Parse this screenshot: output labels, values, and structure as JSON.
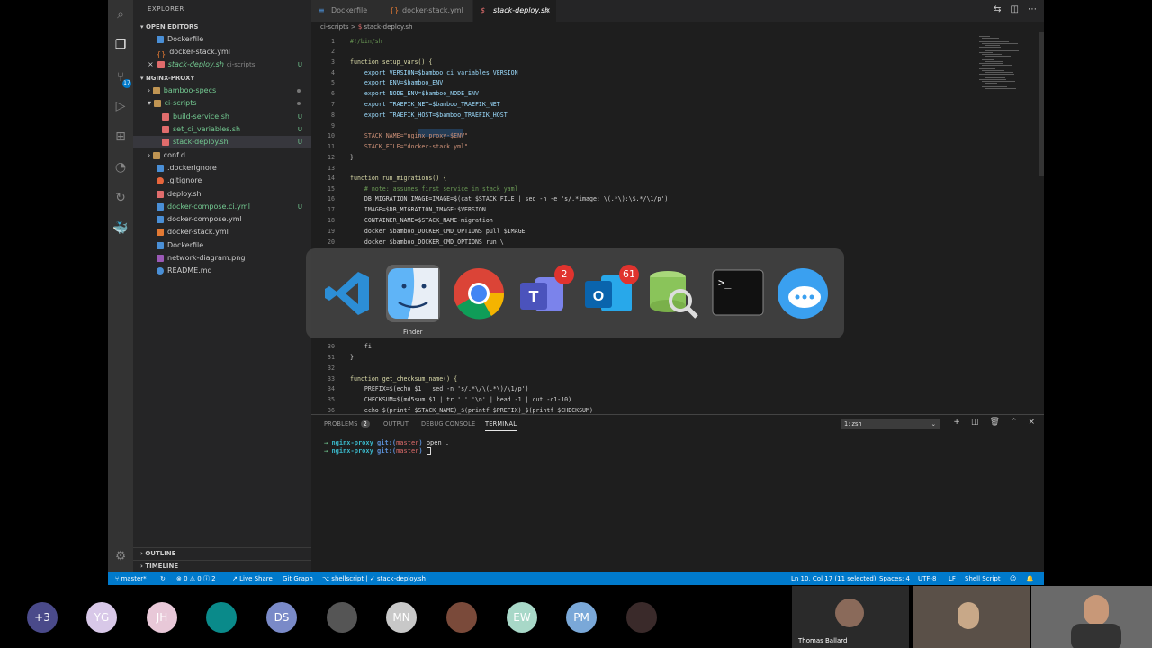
{
  "explorer": {
    "title": "EXPLORER",
    "open_editors_label": "OPEN EDITORS",
    "open_editors": [
      {
        "name": "Dockerfile"
      },
      {
        "name": "docker-stack.yml"
      },
      {
        "name": "stack-deploy.sh",
        "desc": "ci-scripts",
        "status": "U"
      }
    ],
    "project_label": "NGINX-PROXY",
    "tree": [
      {
        "name": "bamboo-specs",
        "status": ""
      },
      {
        "name": "ci-scripts",
        "status": ""
      },
      {
        "name": "build-service.sh",
        "status": "U"
      },
      {
        "name": "set_ci_variables.sh",
        "status": "U"
      },
      {
        "name": "stack-deploy.sh",
        "status": "U"
      },
      {
        "name": "conf.d",
        "status": ""
      },
      {
        "name": ".dockerignore",
        "status": ""
      },
      {
        "name": ".gitignore",
        "status": ""
      },
      {
        "name": "deploy.sh",
        "status": ""
      },
      {
        "name": "docker-compose.ci.yml",
        "status": "U"
      },
      {
        "name": "docker-compose.yml",
        "status": ""
      },
      {
        "name": "docker-stack.yml",
        "status": ""
      },
      {
        "name": "Dockerfile",
        "status": ""
      },
      {
        "name": "network-diagram.png",
        "status": ""
      },
      {
        "name": "README.md",
        "status": ""
      }
    ],
    "outline_label": "OUTLINE",
    "timeline_label": "TIMELINE"
  },
  "tabs": [
    {
      "label": "Dockerfile"
    },
    {
      "label": "docker-stack.yml"
    },
    {
      "label": "stack-deploy.sh"
    }
  ],
  "breadcrumb": {
    "folder": "ci-scripts",
    "sep": ">",
    "file": "stack-deploy.sh"
  },
  "code_lines": [
    {
      "n": "1",
      "t": "#!/bin/sh"
    },
    {
      "n": "2",
      "t": ""
    },
    {
      "n": "3",
      "t": "function setup_vars() {"
    },
    {
      "n": "4",
      "t": "    export VERSION=$bamboo_ci_variables_VERSION"
    },
    {
      "n": "5",
      "t": "    export ENV=$bamboo_ENV"
    },
    {
      "n": "6",
      "t": "    export NODE_ENV=$bamboo_NODE_ENV"
    },
    {
      "n": "7",
      "t": "    export TRAEFIK_NET=$bamboo_TRAEFIK_NET"
    },
    {
      "n": "8",
      "t": "    export TRAEFIK_HOST=$bamboo_TRAEFIK_HOST"
    },
    {
      "n": "9",
      "t": ""
    },
    {
      "n": "10",
      "t": "    STACK_NAME=\"nginx_proxy-$ENV\""
    },
    {
      "n": "11",
      "t": "    STACK_FILE=\"docker-stack.yml\""
    },
    {
      "n": "12",
      "t": "}"
    },
    {
      "n": "13",
      "t": ""
    },
    {
      "n": "14",
      "t": "function run_migrations() {"
    },
    {
      "n": "15",
      "t": "    # note: assumes first service in stack yaml"
    },
    {
      "n": "16",
      "t": "    DB_MIGRATION_IMAGE=IMAGE=$(cat $STACK_FILE | sed -n -e 's/.*image: \\(.*\\):\\$.*/\\1/p')"
    },
    {
      "n": "17",
      "t": "    IMAGE=$DB_MIGRATION_IMAGE:$VERSION"
    },
    {
      "n": "18",
      "t": "    CONTAINER_NAME=$STACK_NAME-migration"
    },
    {
      "n": "19",
      "t": "    docker $bamboo_DOCKER_CMD_OPTIONS pull $IMAGE"
    },
    {
      "n": "20",
      "t": "    docker $bamboo_DOCKER_CMD_OPTIONS run \\"
    },
    {
      "n": "30",
      "t": "    fi"
    },
    {
      "n": "31",
      "t": "}"
    },
    {
      "n": "32",
      "t": ""
    },
    {
      "n": "33",
      "t": "function get_checksum_name() {"
    },
    {
      "n": "34",
      "t": "    PREFIX=$(echo $1 | sed -n 's/.*\\/\\(.*\\)/\\1/p')"
    },
    {
      "n": "35",
      "t": "    CHECKSUM=$(md5sum $1 | tr ' ' '\\n' | head -1 | cut -c1-10)"
    },
    {
      "n": "36",
      "t": "    echo $(printf $STACK_NAME)_$(printf $PREFIX)_$(printf $CHECKSUM)"
    }
  ],
  "panel": {
    "tabs": [
      "PROBLEMS",
      "OUTPUT",
      "DEBUG CONSOLE",
      "TERMINAL"
    ],
    "problems_count": "2",
    "terminal_select": "1: zsh",
    "lines": [
      {
        "arrow": "→",
        "dir": "nginx-proxy",
        "git": "git:(",
        "branch": "master",
        "close": ")",
        "cmd": " open ."
      },
      {
        "arrow": "→",
        "dir": "nginx-proxy",
        "git": "git:(",
        "branch": "master",
        "close": ")",
        "cmd": " "
      }
    ]
  },
  "statusbar": {
    "branch": "master*",
    "problems": "⊗ 0 ⚠ 0 ⓘ 2",
    "live_share": "Live Share",
    "git_graph": "Git Graph",
    "shellscript": "shellscript | ✓ stack-deploy.sh",
    "position": "Ln 10, Col 17 (11 selected)",
    "spaces": "Spaces: 4",
    "encoding": "UTF-8",
    "eol": "LF",
    "language": "Shell Script"
  },
  "switcher": {
    "apps": [
      {
        "name": "vscode-icon"
      },
      {
        "name": "finder-icon"
      },
      {
        "name": "chrome-icon"
      },
      {
        "name": "teams-icon",
        "badge": "2"
      },
      {
        "name": "outlook-icon",
        "badge": "61"
      },
      {
        "name": "database-icon"
      },
      {
        "name": "terminal-icon",
        "text": ">_"
      },
      {
        "name": "messages-icon"
      }
    ],
    "selected_label": "Finder"
  },
  "participants": [
    {
      "initials": "+3",
      "color": "#4a4a8a"
    },
    {
      "initials": "YG",
      "color": "#d8c8e8"
    },
    {
      "initials": "JH",
      "color": "#e8c8d8"
    },
    {
      "initials": "",
      "color": "#0a8a8a"
    },
    {
      "initials": "DS",
      "color": "#7a8ac8"
    },
    {
      "initials": "",
      "color": "#555555"
    },
    {
      "initials": "MN",
      "color": "#c8c8c8"
    },
    {
      "initials": "",
      "color": "#7a4a3a"
    },
    {
      "initials": "EW",
      "color": "#a8d8c8"
    },
    {
      "initials": "PM",
      "color": "#7aa8d8"
    },
    {
      "initials": "",
      "color": "#3a2a2a"
    }
  ],
  "video_name": "Thomas Ballard"
}
